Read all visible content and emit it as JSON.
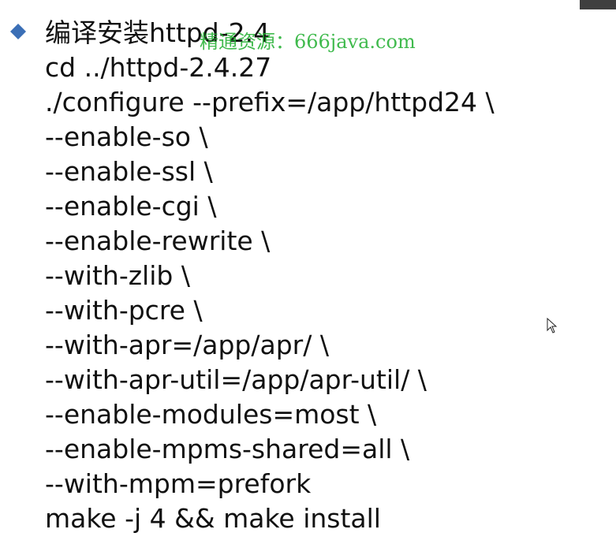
{
  "slide": {
    "title": "编译安装httpd-2.4",
    "watermark": "精通资源：666java.com",
    "lines": [
      "cd ../httpd-2.4.27",
      "./configure --prefix=/app/httpd24 \\",
      "--enable-so \\",
      "--enable-ssl \\",
      "--enable-cgi \\",
      "--enable-rewrite \\",
      "--with-zlib \\",
      "--with-pcre \\",
      "--with-apr=/app/apr/ \\",
      "--with-apr-util=/app/apr-util/ \\",
      "--enable-modules=most \\",
      "--enable-mpms-shared=all \\",
      "--with-mpm=prefork",
      "make -j 4 && make install"
    ]
  },
  "icons": {
    "bullet": "diamond-bullet-icon",
    "cursor": "mouse-pointer-icon"
  },
  "colors": {
    "bullet": "#3b6fb6",
    "watermark": "#1fae2f",
    "text": "#111111",
    "background": "#ffffff"
  }
}
